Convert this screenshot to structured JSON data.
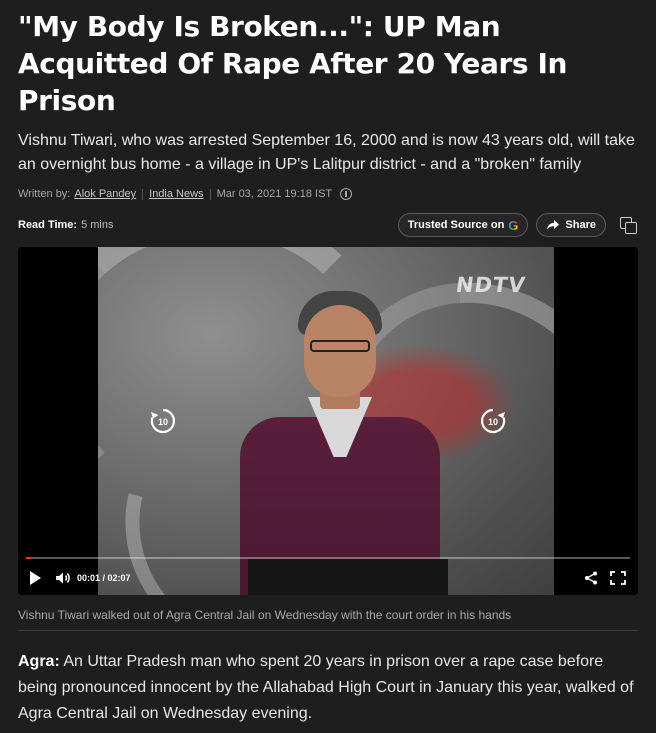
{
  "article": {
    "headline": "\"My Body Is Broken...\": UP Man Acquitted Of Rape After 20 Years In Prison",
    "summary": "Vishnu Tiwari, who was arrested September 16, 2000 and is now 43 years old, will take an overnight bus home - a village in UP's Lalitpur district - and a \"broken\" family",
    "meta": {
      "written_by_label": "Written by:",
      "author": "Alok Pandey",
      "section": "India News",
      "date": "Mar 03, 2021 19:18 IST"
    },
    "read_time": {
      "label": "Read Time:",
      "value": "5 mins"
    },
    "actions": {
      "trusted_source_label": "Trusted Source on",
      "trusted_source_logo": "G",
      "share_label": "Share"
    }
  },
  "video": {
    "channel_logo": "NDTV",
    "skip_back_label": "10",
    "skip_forward_label": "10",
    "current_time": "00:01",
    "duration": "02:07",
    "time_display": "00:01 / 02:07",
    "progress_fraction": 0.008,
    "accent_color": "#e53935",
    "caption": "Vishnu Tiwari walked out of Agra Central Jail on Wednesday with the court order in his hands"
  },
  "body": {
    "dateline": "Agra:",
    "paragraph": " An Uttar Pradesh man who spent 20 years in prison over a rape case before being pronounced innocent by the Allahabad High Court in January this year, walked of Agra Central Jail on Wednesday evening."
  }
}
